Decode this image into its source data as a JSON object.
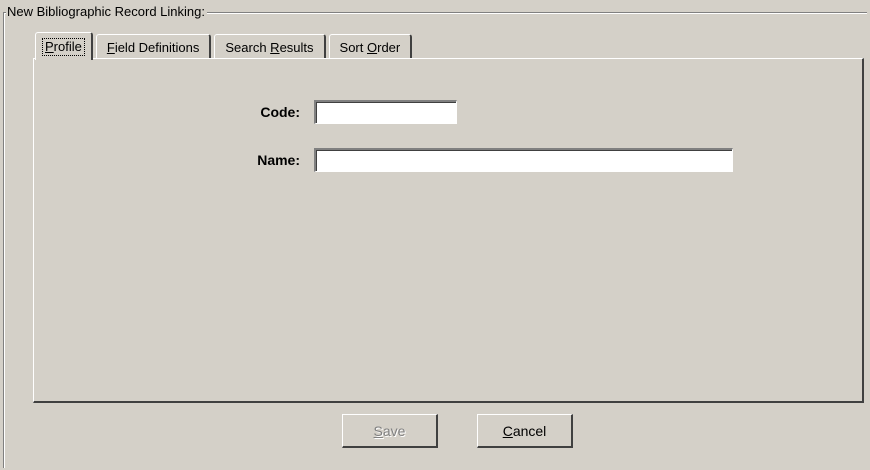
{
  "group": {
    "title": "New Bibliographic Record Linking:"
  },
  "tabs": [
    {
      "prefix": "",
      "accel": "P",
      "suffix": "rofile",
      "active": true
    },
    {
      "prefix": "",
      "accel": "F",
      "suffix": "ield Definitions",
      "active": false
    },
    {
      "prefix": "Search ",
      "accel": "R",
      "suffix": "esults",
      "active": false
    },
    {
      "prefix": "Sort ",
      "accel": "O",
      "suffix": "rder",
      "active": false
    }
  ],
  "form": {
    "code_label": "Code:",
    "code_value": "",
    "name_label": "Name:",
    "name_value": ""
  },
  "buttons": {
    "save": {
      "accel": "S",
      "suffix": "ave",
      "enabled": false
    },
    "cancel": {
      "accel": "C",
      "suffix": "ancel",
      "enabled": true
    }
  }
}
